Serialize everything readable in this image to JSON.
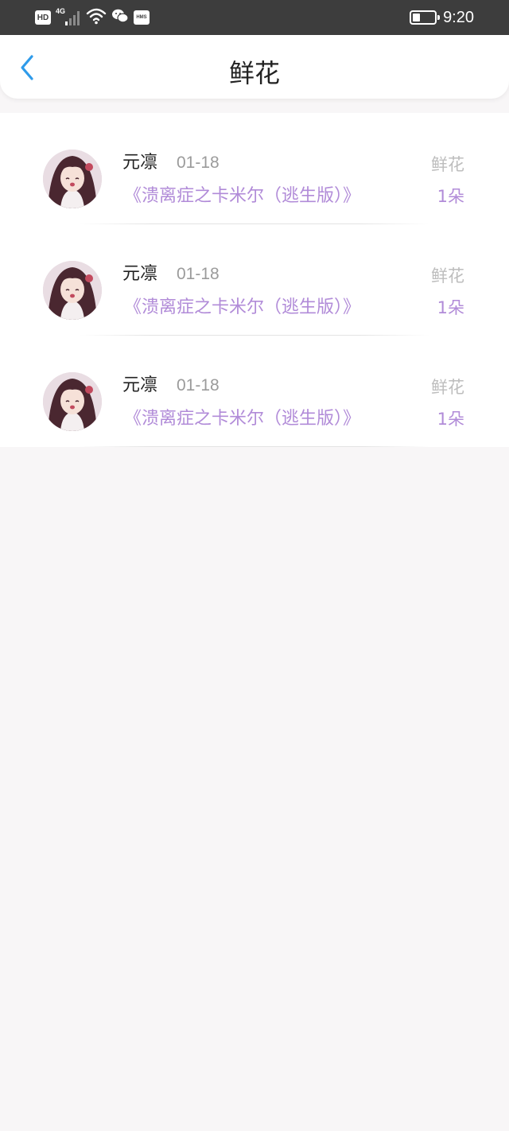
{
  "status_bar": {
    "hd_label": "HD",
    "network_label": "4G",
    "hms_label": "HMS",
    "battery_level": 0.35,
    "time": "9:20"
  },
  "header": {
    "title": "鲜花",
    "back_icon": "chevron-left-icon"
  },
  "colors": {
    "accent": "#2f9bea",
    "book_title": "#b18bd8",
    "status_bar_bg": "#3d3d3d"
  },
  "records": [
    {
      "name": "元凛",
      "date": "01-18",
      "gift_type": "鲜花",
      "book": "《溃离症之卡米尔（逃生版）》",
      "count": "1朵"
    },
    {
      "name": "元凛",
      "date": "01-18",
      "gift_type": "鲜花",
      "book": "《溃离症之卡米尔（逃生版）》",
      "count": "1朵"
    },
    {
      "name": "元凛",
      "date": "01-18",
      "gift_type": "鲜花",
      "book": "《溃离症之卡米尔（逃生版）》",
      "count": "1朵"
    }
  ]
}
